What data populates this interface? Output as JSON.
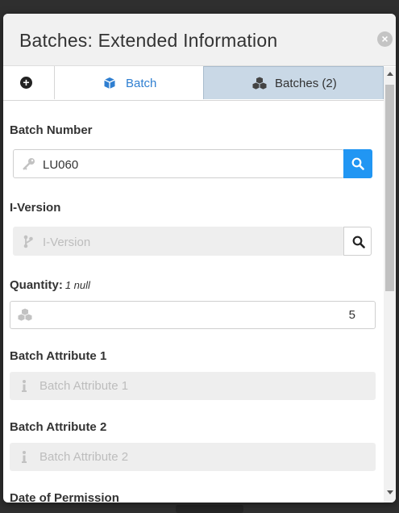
{
  "window": {
    "title": "Batches: Extended Information",
    "close_icon": "close-circle-icon"
  },
  "tabs": {
    "add_icon": "plus-circle-icon",
    "batch": {
      "label": "Batch",
      "icon": "cube-icon",
      "color": "#2f7fd1"
    },
    "batches": {
      "label": "Batches (2)",
      "icon": "cubes-icon",
      "background": "#c9d8e6"
    }
  },
  "form": {
    "batch_number": {
      "label": "Batch Number",
      "value": "LU060",
      "icon": "key-icon",
      "search_button_icon": "search-icon",
      "search_button_color": "#2196f3"
    },
    "i_version": {
      "label": "I-Version",
      "placeholder": "I-Version",
      "icon": "code-branch-icon",
      "search_button_icon": "search-icon"
    },
    "quantity": {
      "label": "Quantity:",
      "sublabel": "1 null",
      "value": "5",
      "icon": "cubes-icon"
    },
    "batch_attribute_1": {
      "label": "Batch Attribute 1",
      "placeholder": "Batch Attribute 1",
      "icon": "info-icon"
    },
    "batch_attribute_2": {
      "label": "Batch Attribute 2",
      "placeholder": "Batch Attribute 2",
      "icon": "info-icon"
    },
    "date_of_permission": {
      "label": "Date of Permission"
    }
  }
}
